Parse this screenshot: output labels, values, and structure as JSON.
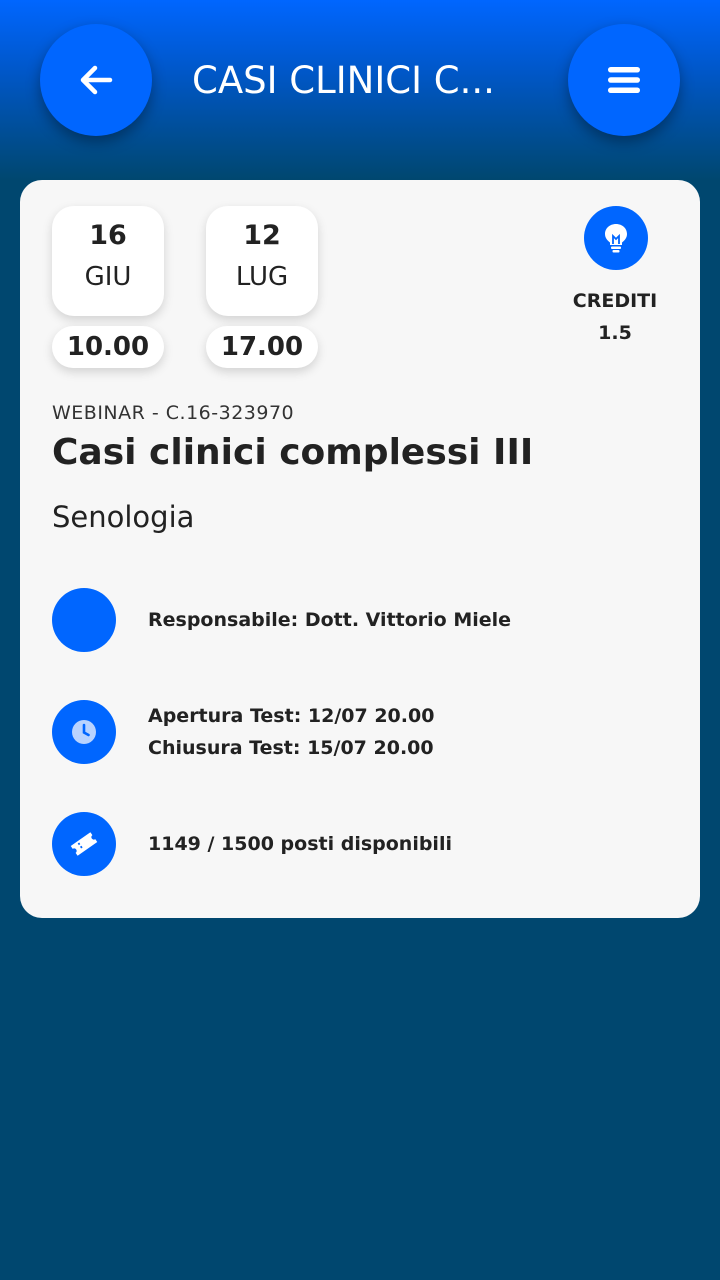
{
  "header": {
    "title": "CASI CLINICI C...",
    "back_icon": "arrow-left-icon",
    "menu_icon": "hamburger-menu-icon",
    "accent_color": "#0066ff",
    "background_color": "#00476f"
  },
  "event": {
    "start": {
      "day": "16",
      "month": "GIU",
      "time": "10.00"
    },
    "end": {
      "day": "12",
      "month": "LUG",
      "time": "17.00"
    },
    "credits": {
      "icon": "lightbulb-icon",
      "label": "CREDITI",
      "value": "1.5"
    },
    "code": "WEBINAR - C.16-323970",
    "title": "Casi clinici complessi III",
    "subtitle": "Senologia",
    "info": {
      "responsible": {
        "icon": "user-icon",
        "text": "Responsabile: Dott. Vittorio Miele"
      },
      "test": {
        "icon": "clock-icon",
        "opening": "Apertura Test: 12/07 20.00",
        "closing": "Chiusura Test: 15/07 20.00"
      },
      "seats": {
        "icon": "ticket-icon",
        "text": "1149 / 1500 posti disponibili"
      }
    }
  }
}
